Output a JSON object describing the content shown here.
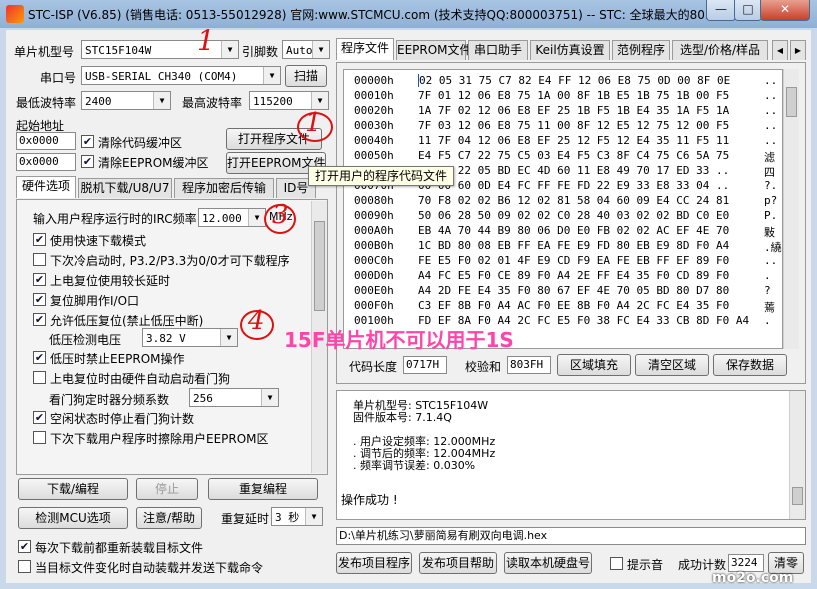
{
  "window": {
    "title": "STC-ISP (V6.85) (销售电话: 0513-55012928) 官网:www.STCMCU.com  (技术支持QQ:800003751)  -- STC: 全球最大的80...",
    "min_label": "—",
    "max_label": "□",
    "close_label": "✕"
  },
  "left": {
    "mcu_label": "单片机型号",
    "mcu_value": "STC15F104W",
    "pins_label": "引脚数",
    "pins_value": "Auto",
    "port_label": "串口号",
    "port_value": "USB-SERIAL CH340 (COM4)",
    "scan_btn": "扫描",
    "min_baud_label": "最低波特率",
    "min_baud_value": "2400",
    "max_baud_label": "最高波特率",
    "max_baud_value": "115200",
    "start_addr_label": "起始地址",
    "addr1": "0x0000",
    "clear_code_label": "清除代码缓冲区",
    "open_prog_btn": "打开程序文件",
    "addr2": "0x0000",
    "clear_eeprom_label": "清除EEPROM缓冲区",
    "open_eeprom_btn": "打开EEPROM文件",
    "tooltip": "打开用户的程序代码文件"
  },
  "hw_tabs": [
    "硬件选项",
    "脱机下载/U8/U7",
    "程序加密后传输",
    "ID号"
  ],
  "options": {
    "irc_label": "输入用户程序运行时的IRC频率",
    "irc_value": "12.000",
    "irc_unit": "MHz",
    "items": [
      {
        "label": "使用快速下载模式",
        "checked": true
      },
      {
        "label": "下次冷启动时, P3.2/P3.3为0/0才可下载程序",
        "checked": false
      },
      {
        "label": "上电复位使用较长延时",
        "checked": true
      },
      {
        "label": "复位脚用作I/O口",
        "checked": true
      },
      {
        "label": "允许低压复位(禁止低压中断)",
        "checked": true
      }
    ],
    "lvd_label": "低压检测电压",
    "lvd_value": "3.82 V",
    "items2": [
      {
        "label": "低压时禁止EEPROM操作",
        "checked": true
      },
      {
        "label": "上电复位时由硬件自动启动看门狗",
        "checked": false
      }
    ],
    "wdt_label": "看门狗定时器分频系数",
    "wdt_value": "256",
    "items3": [
      {
        "label": "空闲状态时停止看门狗计数",
        "checked": true
      },
      {
        "label": "下次下载用户程序时擦除用户EEPROM区",
        "checked": false
      }
    ]
  },
  "bottom_left": {
    "download_btn": "下载/编程",
    "stop_btn": "停止",
    "reprog_btn": "重复编程",
    "check_btn": "检测MCU选项",
    "help_btn": "注意/帮助",
    "delay_label": "重复延时",
    "delay_value": "3 秒",
    "reload_label": "每次下载前都重新装载目标文件",
    "reload_checked": true,
    "auto_label": "当目标文件变化时自动装载并发送下载命令",
    "auto_checked": false
  },
  "right_tabs": [
    "程序文件",
    "EEPROM文件",
    "串口助手",
    "Keil仿真设置",
    "范例程序",
    "选型/价格/样品"
  ],
  "hex": {
    "rows": [
      {
        "addr": "00000h",
        "bytes": "02 05 31 75 C7 82 E4 FF 12 06 E8 75 0D 00 8F 0E",
        "asc": ".."
      },
      {
        "addr": "00010h",
        "bytes": "7F 01 12 06 E8 75 1A 00 8F 1B E5 1B 75 1B 00 F5",
        "asc": ".."
      },
      {
        "addr": "00020h",
        "bytes": "1A 7F 02 12 06 E8 EF 25 1B F5 1B E4 35 1A F5 1A",
        "asc": ".."
      },
      {
        "addr": "00030h",
        "bytes": "7F 03 12 06 E8 75 11 00 8F 12 E5 12 75 12 00 F5",
        "asc": ".."
      },
      {
        "addr": "00040h",
        "bytes": "11 7F 04 12 06 E8 EF 25 12 F5 12 E4 35 11 F5 11",
        "asc": ".."
      },
      {
        "addr": "00050h",
        "bytes": "E4 F5 C7 22 75 C5 03 E4 F5 C3 8F C4 75 C6 5A 75",
        "asc": "滤"
      },
      {
        "addr": "00060h",
        "bytes": "C6 A5 22 05 BD EC 4D 60 11 E8 49 70 17 ED 33 ..",
        "asc": "四"
      },
      {
        "addr": "00070h",
        "bytes": "00 00 60 0D E4 FC FF FE FD 22 E9 33 E8 33 04 ..",
        "asc": "?."
      },
      {
        "addr": "00080h",
        "bytes": "70 F8 02 02 B6 12 02 81 58 04 60 09 E4 CC 24 81",
        "asc": "p?"
      },
      {
        "addr": "00090h",
        "bytes": "50 06 28 50 09 02 02 C0 28 40 03 02 02 BD C0 E0",
        "asc": "P."
      },
      {
        "addr": "000A0h",
        "bytes": "EB 4A 70 44 B9 80 06 D0 E0 FB 02 02 AC EF 4E 70",
        "asc": "敤"
      },
      {
        "addr": "000B0h",
        "bytes": "1C BD 80 08 EB FF EA FE E9 FD 80 EB E9 8D F0 A4",
        "asc": ".繞"
      },
      {
        "addr": "000C0h",
        "bytes": "FE E5 F0 02 01 4F E9 CD F9 EA FE EB FF EF 89 F0",
        "asc": ".."
      },
      {
        "addr": "000D0h",
        "bytes": "A4 FC E5 F0 CE 89 F0 A4 2E FF E4 35 F0 CD 89 F0",
        "asc": "."
      },
      {
        "addr": "000E0h",
        "bytes": "A4 2D FE E4 35 F0 80 67 EF 4E 70 05 BD 80 D7 80",
        "asc": "?"
      },
      {
        "addr": "000F0h",
        "bytes": "C3 EF 8B F0 A4 AC F0 EE 8B F0 A4 2C FC E4 35 F0",
        "asc": "蔫"
      },
      {
        "addr": "00100h",
        "bytes": "FD EF 8A F0 A4 2C FC E5 F0 38 FC E4 33 CB 8D F0 A4",
        "asc": "."
      }
    ],
    "code_len_label": "代码长度",
    "code_len_value": "0717H",
    "checksum_label": "校验和",
    "checksum_value": "803FH",
    "fill_btn": "区域填充",
    "clear_btn": "清空区域",
    "save_btn": "保存数据"
  },
  "overlay_text": "15F单片机不可以用于1S",
  "annotations": [
    "1",
    "1",
    "3",
    "4"
  ],
  "log": {
    "lines": [
      "单片机型号: STC15F104W",
      "固件版本号: 7.1.4Q",
      "",
      ". 用户设定频率: 12.000MHz",
      ". 调节后的频率: 12.004MHz",
      ". 频率调节误差: 0.030%",
      "",
      "操作成功 !"
    ]
  },
  "file_path": "D:\\单片机练习\\萝丽简易有刷双向电调.hex",
  "bottom_right": {
    "publish_prog_btn": "发布项目程序",
    "publish_help_btn": "发布项目帮助",
    "read_disk_btn": "读取本机硬盘号",
    "tone_label": "提示音",
    "tone_checked": false,
    "success_label": "成功计数",
    "success_value": "3224",
    "reset_btn": "清零"
  },
  "watermark": "mo2o.com",
  "colors": {
    "annotation": "#dd1111",
    "overlay": "#ff44aa",
    "selection": "#1a4fd0"
  }
}
